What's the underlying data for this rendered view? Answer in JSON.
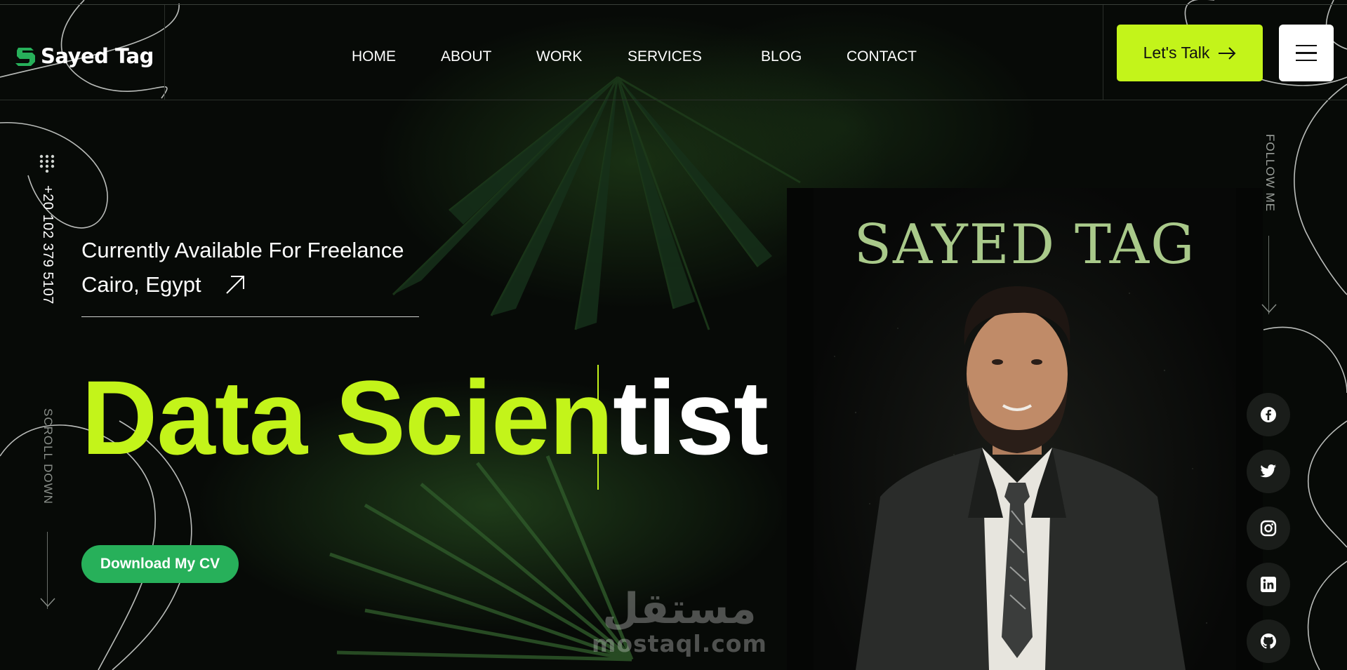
{
  "brand": {
    "name": "Sayed Tag",
    "accent": "#c3f41a",
    "logo_color": "#27b05a"
  },
  "nav": {
    "items": [
      {
        "label": "HOME"
      },
      {
        "label": "ABOUT"
      },
      {
        "label": "WORK"
      },
      {
        "label": "SERVICES"
      },
      {
        "label": "BLOG"
      },
      {
        "label": "CONTACT"
      }
    ]
  },
  "header": {
    "talk_label": "Let's Talk",
    "talk_icon": "arrow-right-icon",
    "menu_icon": "hamburger-icon"
  },
  "left_rail": {
    "phone": "+20 102 379 5107",
    "scroll": "SCROLL DOWN",
    "dial_icon": "dialpad-icon"
  },
  "hero": {
    "availability": "Currently Available For Freelance",
    "location": "Cairo, Egypt",
    "headline_accent": "Data Scien",
    "headline_rest": "tist",
    "cv_button": "Download My CV"
  },
  "portrait": {
    "title": "SAYED TAG"
  },
  "right_rail": {
    "follow": "FOLLOW ME",
    "socials": [
      {
        "name": "facebook-icon"
      },
      {
        "name": "twitter-icon"
      },
      {
        "name": "instagram-icon"
      },
      {
        "name": "linkedin-icon"
      },
      {
        "name": "github-icon"
      }
    ]
  },
  "watermark": {
    "arabic": "مستقل",
    "latin": "mostaql.com"
  }
}
